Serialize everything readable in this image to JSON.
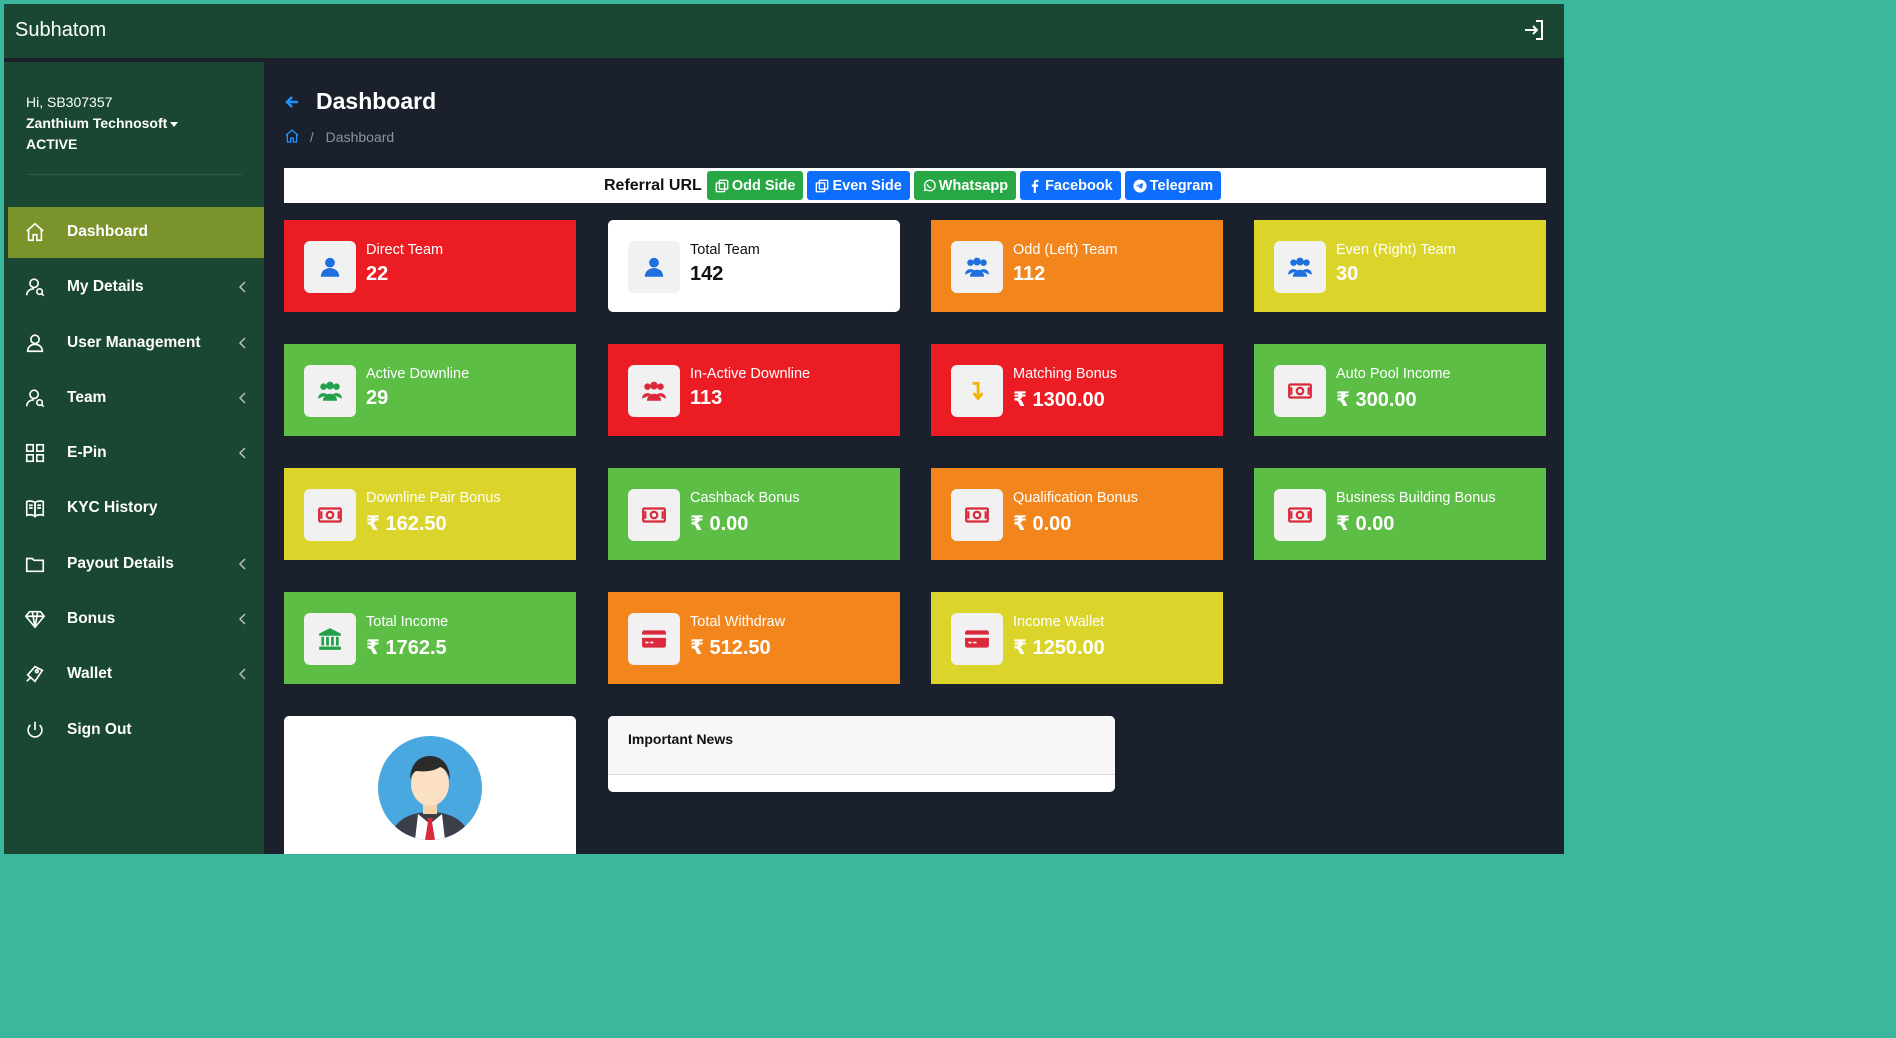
{
  "app": {
    "brand": "Subhatom"
  },
  "user": {
    "greeting": "Hi, SB307357",
    "company": "Zanthium Technosoft",
    "status": "ACTIVE"
  },
  "sidebar": {
    "items": [
      {
        "label": "Dashboard",
        "icon": "home-icon",
        "active": true,
        "has_submenu": false
      },
      {
        "label": "My Details",
        "icon": "user-details-icon",
        "has_submenu": true
      },
      {
        "label": "User Management",
        "icon": "user-icon",
        "has_submenu": true
      },
      {
        "label": "Team",
        "icon": "team-icon",
        "has_submenu": true
      },
      {
        "label": "E-Pin",
        "icon": "grid-icon",
        "has_submenu": true
      },
      {
        "label": "KYC History",
        "icon": "book-icon",
        "has_submenu": false
      },
      {
        "label": "Payout Details",
        "icon": "folder-icon",
        "has_submenu": true
      },
      {
        "label": "Bonus",
        "icon": "diamond-icon",
        "has_submenu": true
      },
      {
        "label": "Wallet",
        "icon": "wallet-icon",
        "has_submenu": true
      },
      {
        "label": "Sign Out",
        "icon": "power-icon",
        "has_submenu": false
      }
    ]
  },
  "page": {
    "title": "Dashboard",
    "breadcrumb_current": "Dashboard",
    "breadcrumb_sep": "/"
  },
  "referral": {
    "label": "Referral URL",
    "buttons": [
      {
        "label": "Odd Side",
        "color": "#28a745",
        "icon": "copy-icon"
      },
      {
        "label": "Even Side",
        "color": "#0d6efd",
        "icon": "copy-icon"
      },
      {
        "label": "Whatsapp",
        "color": "#28a745",
        "icon": "whatsapp-icon"
      },
      {
        "label": "Facebook",
        "color": "#0d6efd",
        "icon": "facebook-icon"
      },
      {
        "label": "Telegram",
        "color": "#0d6efd",
        "icon": "telegram-icon"
      }
    ]
  },
  "cards": [
    {
      "label": "Direct Team",
      "value": "22",
      "color": "#ec1c24",
      "icon": "user-icon"
    },
    {
      "label": "Total Team",
      "value": "142",
      "color": "#ffffff",
      "icon": "user-icon"
    },
    {
      "label": "Odd (Left) Team",
      "value": "112",
      "color": "#f2861d",
      "icon": "users-icon"
    },
    {
      "label": "Even (Right) Team",
      "value": "30",
      "color": "#dbd42b",
      "icon": "users-icon"
    },
    {
      "label": "Active Downline",
      "value": "29",
      "color": "#5dbe45",
      "icon": "users-icon"
    },
    {
      "label": "In-Active Downline",
      "value": "113",
      "color": "#ec1c24",
      "icon": "users-icon"
    },
    {
      "label": "Matching Bonus",
      "value": "₹ 1300.00",
      "color": "#ec1c24",
      "icon": "level-down-icon"
    },
    {
      "label": "Auto Pool Income",
      "value": "₹ 300.00",
      "color": "#5dbe45",
      "icon": "money-icon"
    },
    {
      "label": "Downline Pair Bonus",
      "value": "₹ 162.50",
      "color": "#dbd42b",
      "icon": "money-icon"
    },
    {
      "label": "Cashback Bonus",
      "value": "₹ 0.00",
      "color": "#5dbe45",
      "icon": "money-icon"
    },
    {
      "label": "Qualification Bonus",
      "value": "₹ 0.00",
      "color": "#f2861d",
      "icon": "money-icon"
    },
    {
      "label": "Business Building Bonus",
      "value": "₹ 0.00",
      "color": "#5dbe45",
      "icon": "money-icon"
    },
    {
      "label": "Total Income",
      "value": "₹ 1762.5",
      "color": "#5dbe45",
      "icon": "bank-icon"
    },
    {
      "label": "Total Withdraw",
      "value": "₹ 512.50",
      "color": "#f2861d",
      "icon": "credit-card-icon"
    },
    {
      "label": "Income Wallet",
      "value": "₹ 1250.00",
      "color": "#dbd42b",
      "icon": "credit-card-icon"
    }
  ],
  "news": {
    "title": "Important News"
  }
}
